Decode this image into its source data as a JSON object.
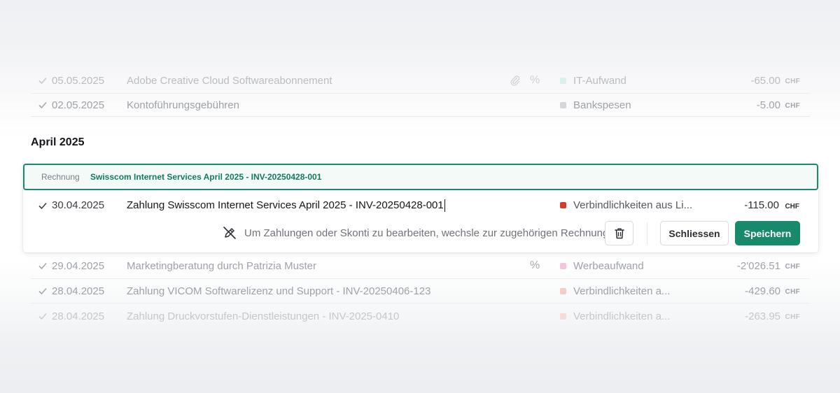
{
  "rows_above": [
    {
      "date": "05.05.2025",
      "description": "Adobe Creative Cloud Softwareabonnement",
      "has_attachment": true,
      "has_percent": true,
      "percent_symbol": "%",
      "category": "IT-Aufwand",
      "category_color": "#bfe9e3",
      "amount": "-65.00",
      "currency": "CHF"
    },
    {
      "date": "02.05.2025",
      "description": "Kontoführungsgebühren",
      "has_attachment": false,
      "has_percent": false,
      "category": "Bankspesen",
      "category_color": "#cfd1d4",
      "amount": "-5.00",
      "currency": "CHF"
    }
  ],
  "section": {
    "title": "April 2025"
  },
  "editing": {
    "invoice_label": "Rechnung",
    "invoice_link": "Swisscom Internet Services April 2025 - INV-20250428-001",
    "date": "30.04.2025",
    "description_value": "Zahlung Swisscom Internet Services April 2025 - INV-20250428-001",
    "category": "Verbindlichkeiten aus Li...",
    "category_color": "#d63a2b",
    "amount": "-115.00",
    "currency": "CHF",
    "hint": "Um Zahlungen oder Skonti zu bearbeiten, wechsle zur zugehörigen Rechnung.",
    "close_label": "Schliessen",
    "save_label": "Speichern",
    "accent_color": "#188a6c"
  },
  "rows_below": [
    {
      "date": "29.04.2025",
      "description": "Marketingberatung durch Patrizia Muster",
      "has_percent": true,
      "percent_symbol": "%",
      "category": "Werbeaufwand",
      "category_color": "#f2b7d3",
      "amount": "-2'026.51",
      "currency": "CHF"
    },
    {
      "date": "28.04.2025",
      "description": "Zahlung VICOM Softwarelizenz und Support - INV-20250406-123",
      "has_percent": false,
      "category": "Verbindlichkeiten a...",
      "category_color": "#f1c6c1",
      "amount": "-429.60",
      "currency": "CHF"
    },
    {
      "date": "28.04.2025",
      "description": "Zahlung Druckvorstufen-Dienstleistungen - INV-2025-0410",
      "has_percent": false,
      "category": "Verbindlichkeiten a...",
      "category_color": "#f3d3cf",
      "amount": "-263.95",
      "currency": "CHF"
    }
  ]
}
